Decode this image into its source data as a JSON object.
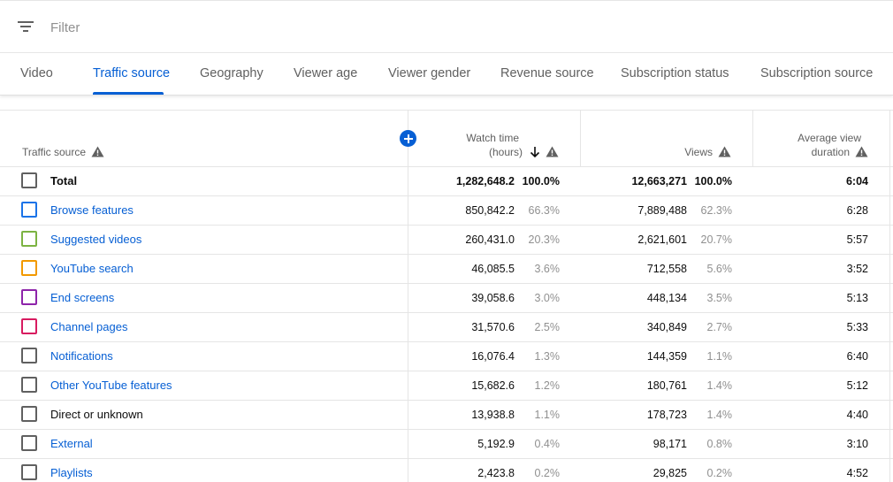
{
  "filter": {
    "placeholder": "Filter"
  },
  "tabs": [
    {
      "label": "Video"
    },
    {
      "label": "Traffic source"
    },
    {
      "label": "Geography"
    },
    {
      "label": "Viewer age"
    },
    {
      "label": "Viewer gender"
    },
    {
      "label": "Revenue source"
    },
    {
      "label": "Subscription status"
    },
    {
      "label": "Subscription source"
    }
  ],
  "active_tab": "Traffic source",
  "table": {
    "headers": {
      "source": "Traffic source",
      "watch_time_line1": "Watch time",
      "watch_time_line2": "(hours)",
      "views": "Views",
      "avg_view_line1": "Average view",
      "avg_view_line2": "duration"
    },
    "total": {
      "label": "Total",
      "watch_time": "1,282,648.2",
      "watch_pct": "100.0%",
      "views": "12,663,271",
      "views_pct": "100.0%",
      "avg_duration": "6:04"
    },
    "rows": [
      {
        "label": "Browse features",
        "watch_time": "850,842.2",
        "watch_pct": "66.3%",
        "views": "7,889,488",
        "views_pct": "62.3%",
        "avg_duration": "6:28",
        "color": "#1a73e8",
        "link": true
      },
      {
        "label": "Suggested videos",
        "watch_time": "260,431.0",
        "watch_pct": "20.3%",
        "views": "2,621,601",
        "views_pct": "20.7%",
        "avg_duration": "5:57",
        "color": "#7cb342",
        "link": true
      },
      {
        "label": "YouTube search",
        "watch_time": "46,085.5",
        "watch_pct": "3.6%",
        "views": "712,558",
        "views_pct": "5.6%",
        "avg_duration": "3:52",
        "color": "#f29900",
        "link": true
      },
      {
        "label": "End screens",
        "watch_time": "39,058.6",
        "watch_pct": "3.0%",
        "views": "448,134",
        "views_pct": "3.5%",
        "avg_duration": "5:13",
        "color": "#8e24aa",
        "link": true
      },
      {
        "label": "Channel pages",
        "watch_time": "31,570.6",
        "watch_pct": "2.5%",
        "views": "340,849",
        "views_pct": "2.7%",
        "avg_duration": "5:33",
        "color": "#d81b60",
        "link": true
      },
      {
        "label": "Notifications",
        "watch_time": "16,076.4",
        "watch_pct": "1.3%",
        "views": "144,359",
        "views_pct": "1.1%",
        "avg_duration": "6:40",
        "color": "#606060",
        "link": true
      },
      {
        "label": "Other YouTube features",
        "watch_time": "15,682.6",
        "watch_pct": "1.2%",
        "views": "180,761",
        "views_pct": "1.4%",
        "avg_duration": "5:12",
        "color": "#606060",
        "link": true
      },
      {
        "label": "Direct or unknown",
        "watch_time": "13,938.8",
        "watch_pct": "1.1%",
        "views": "178,723",
        "views_pct": "1.4%",
        "avg_duration": "4:40",
        "color": "#606060",
        "link": false
      },
      {
        "label": "External",
        "watch_time": "5,192.9",
        "watch_pct": "0.4%",
        "views": "98,171",
        "views_pct": "0.8%",
        "avg_duration": "3:10",
        "color": "#606060",
        "link": true
      },
      {
        "label": "Playlists",
        "watch_time": "2,423.8",
        "watch_pct": "0.2%",
        "views": "29,825",
        "views_pct": "0.2%",
        "avg_duration": "4:52",
        "color": "#606060",
        "link": true
      }
    ]
  },
  "colors": {
    "accent": "#065fd4",
    "muted": "#606060",
    "pct": "#909090"
  },
  "icons": {
    "filter": "filter-lines-icon",
    "warning": "warning-triangle-icon",
    "sort": "arrow-down-icon",
    "add": "add-circle-icon"
  }
}
